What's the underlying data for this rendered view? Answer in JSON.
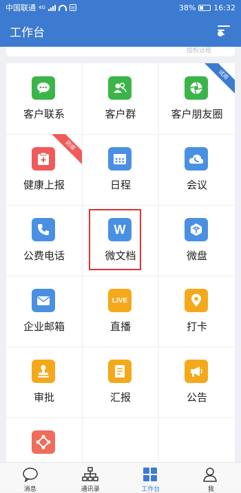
{
  "status_bar": {
    "carrier": "中国联通",
    "network": "4G",
    "battery": "38%",
    "battery_level": 0.38,
    "time": "16:32"
  },
  "header": {
    "title": "工作台",
    "settings_icon": "settings-icon"
  },
  "top_card": {
    "hint": "授权远程"
  },
  "apps": [
    {
      "label": "客户联系",
      "icon": "chat-bubble-icon",
      "color": "#3bb54a"
    },
    {
      "label": "客户群",
      "icon": "group-icon",
      "color": "#3bb54a"
    },
    {
      "label": "客户朋友圈",
      "icon": "aperture-icon",
      "color": "#3bb54a",
      "badge": "试用",
      "badge_color": "#3c7bd0"
    },
    {
      "label": "健康上报",
      "icon": "medical-clipboard-icon",
      "color": "#ef5a5a",
      "badge": "防疫",
      "badge_color": "#ef5a5a"
    },
    {
      "label": "日程",
      "icon": "calendar-icon",
      "color": "#4a90e2"
    },
    {
      "label": "会议",
      "icon": "cloud-phone-icon",
      "color": "#4a90e2"
    },
    {
      "label": "公费电话",
      "icon": "phone-icon",
      "color": "#4a90e2"
    },
    {
      "label": "微文档",
      "icon": "w-document-icon",
      "color": "#4a90e2",
      "letter": "W"
    },
    {
      "label": "微盘",
      "icon": "cube-drive-icon",
      "color": "#4a90e2"
    },
    {
      "label": "企业邮箱",
      "icon": "mail-icon",
      "color": "#4a90e2"
    },
    {
      "label": "直播",
      "icon": "live-icon",
      "color": "#f4a91c",
      "letter": "LIVE"
    },
    {
      "label": "打卡",
      "icon": "location-pin-icon",
      "color": "#f4a91c"
    },
    {
      "label": "审批",
      "icon": "stamp-icon",
      "color": "#f4a91c"
    },
    {
      "label": "汇报",
      "icon": "report-icon",
      "color": "#f4a91c"
    },
    {
      "label": "公告",
      "icon": "megaphone-icon",
      "color": "#f4a91c"
    },
    {
      "label": "",
      "icon": "workflow-icon",
      "color": "#ef6d5a"
    }
  ],
  "tabs": [
    {
      "label": "消息",
      "icon": "message-icon",
      "active": false
    },
    {
      "label": "通讯录",
      "icon": "org-chart-icon",
      "active": false
    },
    {
      "label": "工作台",
      "icon": "grid-icon",
      "active": true
    },
    {
      "label": "我",
      "icon": "person-icon",
      "active": false
    }
  ],
  "accent": "#3c7bd0"
}
